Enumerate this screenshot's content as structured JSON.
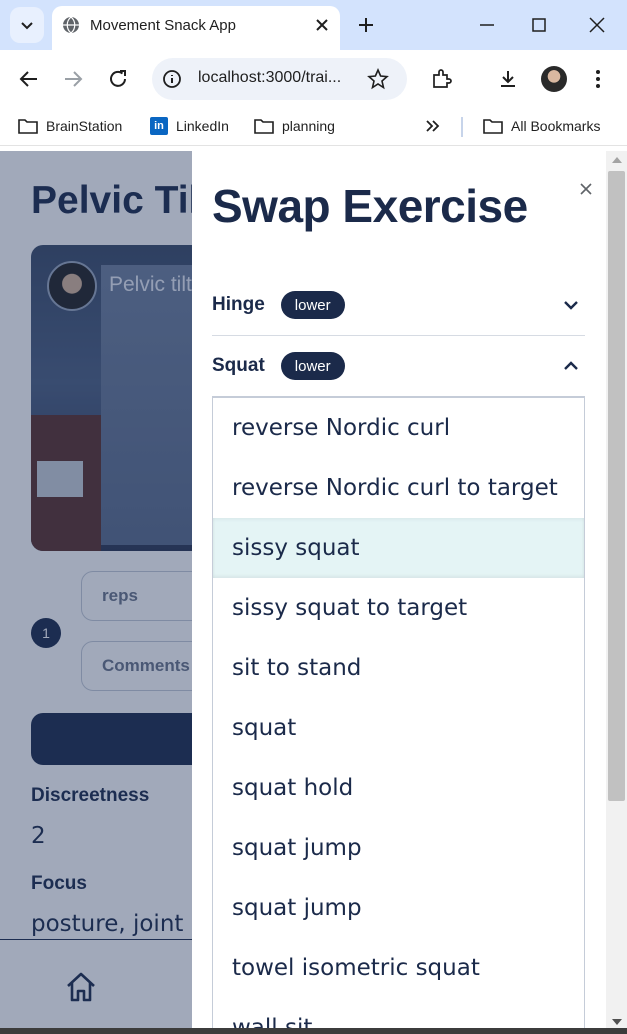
{
  "browser": {
    "tab_title": "Movement Snack App",
    "url": "localhost:3000/trai...",
    "bookmarks": [
      {
        "label": "BrainStation",
        "icon": "folder-icon"
      },
      {
        "label": "LinkedIn",
        "icon": "linkedin-icon"
      },
      {
        "label": "planning",
        "icon": "folder-icon"
      }
    ],
    "all_bookmarks": "All Bookmarks",
    "overflow_icon": "double-chevron-right-icon"
  },
  "page": {
    "title": "Pelvic Tilt",
    "video_title": "Pelvic tilt",
    "set_number": "1",
    "reps_placeholder": "reps",
    "comments_placeholder": "Comments",
    "discreetness_label": "Discreetness",
    "discreetness_value": "2",
    "focus_label": "Focus",
    "focus_value": "posture, joint mobility"
  },
  "drawer": {
    "title": "Swap Exercise",
    "categories": [
      {
        "name": "Hinge",
        "tag": "lower",
        "expanded": false
      },
      {
        "name": "Squat",
        "tag": "lower",
        "expanded": true
      }
    ],
    "exercises": [
      "reverse Nordic curl",
      "reverse Nordic curl to target",
      "sissy squat",
      "sissy squat to target",
      "sit to stand",
      "squat",
      "squat hold",
      "squat jump",
      "squat jump",
      "towel isometric squat",
      "wall sit"
    ],
    "selected_index": 2
  },
  "colors": {
    "navy": "#1b2a4a",
    "selected_row": "#e4f4f5",
    "tab_strip": "#d3e3fd"
  }
}
